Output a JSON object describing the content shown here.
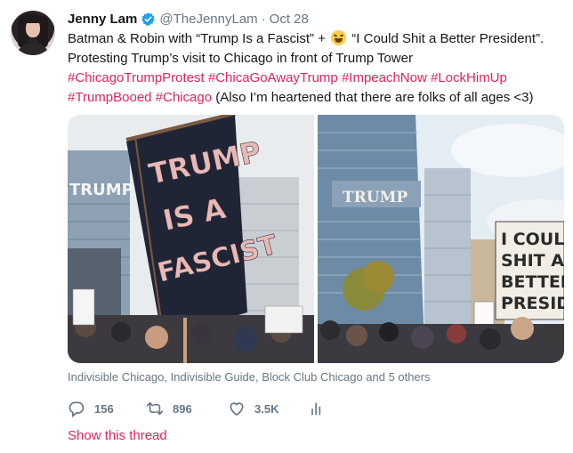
{
  "author": {
    "name": "Jenny Lam",
    "handle": "@TheJennyLam",
    "date": "Oct 28",
    "verified": true,
    "avatar_icon": "avatar-photo"
  },
  "tweet": {
    "line1_a": "Batman & Robin with “Trump Is a Fascist” + ",
    "line1_b": " “I Could Shit a Better President”.",
    "line2": "Protesting Trump’s visit to Chicago in front of Trump Tower",
    "hashtags_line3": [
      "#ChicagoTrumpProtest",
      "#ChicaGoAwayTrump",
      "#ImpeachNow",
      "#LockHimUp"
    ],
    "hashtags_line4": [
      "#TrumpBooed",
      "#Chicago"
    ],
    "line4_tail": "(Also I’m heartened that there are folks of all ages <3)",
    "emoji": "rofl-emoji"
  },
  "media": {
    "left_sign": [
      "TRUMP",
      "IS A",
      "FASCIST"
    ],
    "left_building": "TRUMP",
    "right_building": "TRUMP",
    "right_sign": [
      "I COULD",
      "SHIT A",
      "BETTER",
      "PRESIDEN"
    ]
  },
  "tagged": "Indivisible Chicago, Indivisible Guide, Block Club Chicago and 5 others",
  "actions": {
    "replies": "156",
    "retweets": "896",
    "likes": "3.5K"
  },
  "show_thread": "Show this thread",
  "colors": {
    "link": "#e0245e",
    "muted": "#657786",
    "verified": "#1da1f2"
  }
}
